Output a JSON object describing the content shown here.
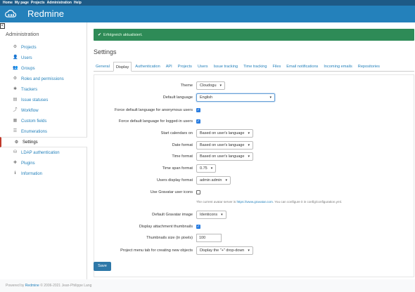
{
  "topnav": {
    "items": [
      "Home",
      "My page",
      "Projects",
      "Administration",
      "Help"
    ]
  },
  "header": {
    "title": "Redmine",
    "logo_icon": "cloud-logo-icon"
  },
  "sidebar": {
    "heading": "Administration",
    "collapse_glyph": "<",
    "items": [
      {
        "label": "Projects",
        "icon": "projects-icon",
        "glyph": "⚙"
      },
      {
        "label": "Users",
        "icon": "user-icon",
        "glyph": "👤"
      },
      {
        "label": "Groups",
        "icon": "group-icon",
        "glyph": "👥"
      },
      {
        "label": "Roles and permissions",
        "icon": "roles-icon",
        "glyph": "⚙"
      },
      {
        "label": "Trackers",
        "icon": "tracker-icon",
        "glyph": "✱"
      },
      {
        "label": "Issue statuses",
        "icon": "issue-status-icon",
        "glyph": "▤"
      },
      {
        "label": "Workflow",
        "icon": "workflow-icon",
        "glyph": "⤴"
      },
      {
        "label": "Custom fields",
        "icon": "custom-fields-icon",
        "glyph": "▦"
      },
      {
        "label": "Enumerations",
        "icon": "enumerations-icon",
        "glyph": "☰"
      },
      {
        "label": "Settings",
        "icon": "settings-icon",
        "glyph": "⚙"
      },
      {
        "label": "LDAP authentication",
        "icon": "ldap-icon",
        "glyph": "⛁"
      },
      {
        "label": "Plugins",
        "icon": "plugins-icon",
        "glyph": "✚"
      },
      {
        "label": "Information",
        "icon": "info-icon",
        "glyph": "ℹ"
      }
    ]
  },
  "flash": {
    "text": "Erfolgreich aktualisiert.",
    "icon": "check-icon",
    "color": "#2e8b57"
  },
  "page_title": "Settings",
  "tabs": [
    "General",
    "Display",
    "Authentication",
    "API",
    "Projects",
    "Users",
    "Issue tracking",
    "Time tracking",
    "Files",
    "Email notifications",
    "Incoming emails",
    "Repositories"
  ],
  "active_tab": "Display",
  "form": {
    "theme": {
      "label": "Theme",
      "value": "Cloudogu"
    },
    "default_language": {
      "label": "Default language",
      "value": "English"
    },
    "force_lang_anon": {
      "label": "Force default language for anonymous users",
      "checked": true
    },
    "force_lang_logged": {
      "label": "Force default language for logged-in users",
      "checked": true
    },
    "start_calendars": {
      "label": "Start calendars on",
      "value": "Based on user's language"
    },
    "date_format": {
      "label": "Date format",
      "value": "Based on user's language"
    },
    "time_format": {
      "label": "Time format",
      "value": "Based on user's language"
    },
    "timespan_format": {
      "label": "Time span format",
      "value": "0.75"
    },
    "users_display": {
      "label": "Users display format",
      "value": "admin admin"
    },
    "gravatar": {
      "label": "Use Gravatar user icons",
      "checked": false
    },
    "gravatar_hint": {
      "prefix": "The current avatar server is",
      "link": "https://www.gravatar.com",
      "suffix": ". You can configure it in config/configuration.yml."
    },
    "default_gravatar": {
      "label": "Default Gravatar image",
      "value": "Identicons"
    },
    "thumbnails": {
      "label": "Display attachment thumbnails",
      "checked": true
    },
    "thumbnail_size": {
      "label": "Thumbnails size (in pixels)",
      "value": "100"
    },
    "project_menu": {
      "label": "Project menu tab for creating new objects",
      "value": "Display the \"+\" drop-down"
    }
  },
  "save_label": "Save",
  "footer": {
    "prefix": "Powered by",
    "link": "Redmine",
    "suffix": "© 2006-2021 Jean-Philippe Lang"
  },
  "colors": {
    "header": "#2481bb",
    "topbar": "#1d5a86",
    "accent": "#2481bb",
    "flash": "#2e8b57"
  }
}
